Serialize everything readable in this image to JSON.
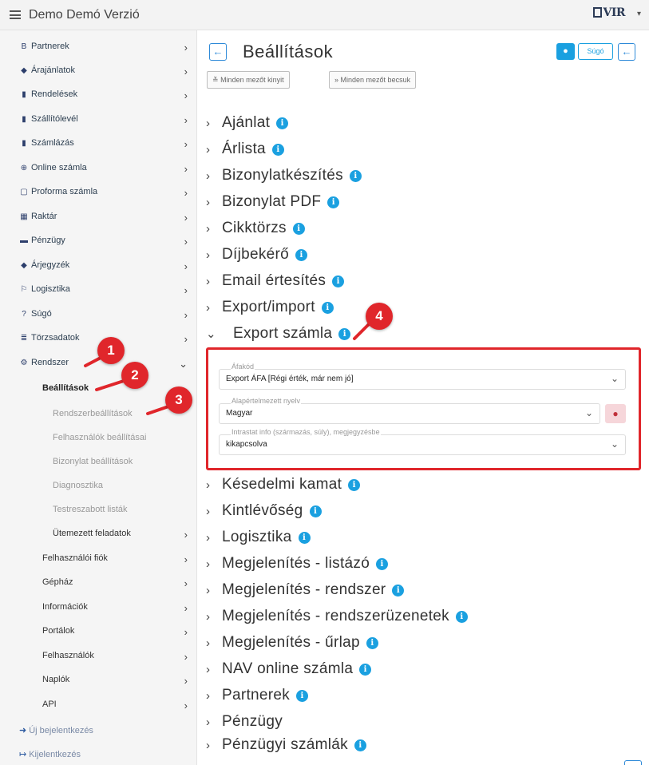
{
  "app": {
    "title": "Demo Demó Verzió",
    "logo_text": "VIR",
    "logo_caret": "▾"
  },
  "sidebar": {
    "items": [
      {
        "icon": "B",
        "label": "Partnerek"
      },
      {
        "icon": "◆",
        "label": "Árajánlatok"
      },
      {
        "icon": "▮",
        "label": "Rendelések"
      },
      {
        "icon": "▮",
        "label": "Szállítólevél"
      },
      {
        "icon": "▮",
        "label": "Számlázás"
      },
      {
        "icon": "⊕",
        "label": "Online számla"
      },
      {
        "icon": "▢",
        "label": "Proforma számla"
      },
      {
        "icon": "▦",
        "label": "Raktár"
      },
      {
        "icon": "▬",
        "label": "Pénzügy"
      },
      {
        "icon": "◆",
        "label": "Árjegyzék"
      },
      {
        "icon": "⚐",
        "label": "Logisztika"
      },
      {
        "icon": "?",
        "label": "Súgó"
      },
      {
        "icon": "≣",
        "label": "Törzsadatok"
      },
      {
        "icon": "⚙",
        "label": "Rendszer"
      }
    ],
    "submenu_active": "Beállítások",
    "subsub": [
      "Rendszerbeállítások",
      "Felhasználók beállításai",
      "Bizonylat beállítások",
      "Diagnosztika",
      "Testreszabott listák"
    ],
    "ütemezett": "Ütemezett feladatok",
    "sub_items": [
      "Felhasználói fiók",
      "Gépház",
      "Információk",
      "Portálok",
      "Felhasználók",
      "Naplók",
      "API"
    ],
    "bottom": [
      {
        "icon": "➜",
        "label": "Új bejelentkezés"
      },
      {
        "icon": "↦",
        "label": "Kijelentkezés"
      }
    ]
  },
  "header": {
    "title": "Beállítások",
    "back_icon": "←",
    "chat_icon": "●",
    "help_label": "Súgó",
    "expand_all": "Minden mezőt kinyit",
    "collapse_all": "Minden mezőt becsuk",
    "expand_icon": "≚",
    "collapse_icon": "»"
  },
  "sections": [
    "Ajánlat",
    "Árlista",
    "Bizonylatkészítés",
    "Bizonylat PDF",
    "Cikktörzs",
    "Díjbekérő",
    "Email értesítés",
    "Export/import",
    "Export számla",
    "Késedelmi kamat",
    "Kintlévőség",
    "Logisztika",
    "Megjelenítés - listázó",
    "Megjelenítés - rendszer",
    "Megjelenítés - rendszerüzenetek",
    "Megjelenítés - űrlap",
    "NAV online számla",
    "Partnerek",
    "Pénzügy",
    "Pénzügyi számlák"
  ],
  "section_has_info": [
    true,
    true,
    true,
    true,
    true,
    true,
    true,
    true,
    true,
    true,
    true,
    true,
    true,
    true,
    true,
    true,
    true,
    true,
    false,
    true
  ],
  "info_icon": "i",
  "expanded_fields": [
    {
      "legend": "Áfakód",
      "value": "Export ÁFA [Régi érték, már nem jó]"
    },
    {
      "legend": "Alapértelmezett nyelv",
      "value": "Magyar"
    },
    {
      "legend": "Intrastat info (származás, súly), megjegyzésbe",
      "value": "kikapcsolva"
    }
  ],
  "callouts": [
    "1",
    "2",
    "3",
    "4"
  ],
  "colors": {
    "accent": "#1aa0e0",
    "highlight": "#e0262b",
    "sidebar_bg": "#f5f5f5"
  }
}
